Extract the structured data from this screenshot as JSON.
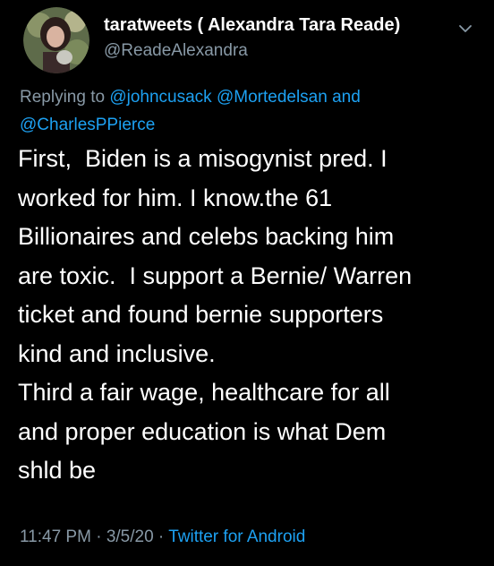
{
  "tweet": {
    "display_name": "taratweets ( Alexandra Tara Reade)",
    "handle": "@ReadeAlexandra",
    "reply": {
      "prefix": "Replying to",
      "mention_1": "@johncusack",
      "mention_2": "@Mortedelsan",
      "conjunction": "and",
      "mention_3": "@CharlesPPierce"
    },
    "body_lines": [
      "First,  Biden is a misogynist pred. I",
      "worked for him. I know.the 61",
      "Billionaires and celebs backing him",
      "are toxic.  I support a Bernie/ Warren",
      "ticket and found bernie supporters",
      "kind and inclusive.",
      "Third a fair wage, healthcare for all",
      "and proper education is what Dem",
      "shld be"
    ],
    "time": "11:47 PM",
    "separator": "·",
    "date": "3/5/20",
    "source": "Twitter for Android"
  },
  "icons": {
    "avatar": "avatar-photo",
    "menu": "chevron-down-icon"
  },
  "colors": {
    "background": "#000000",
    "text": "#ffffff",
    "secondary_text": "#8899a6",
    "link": "#1da1f2"
  }
}
